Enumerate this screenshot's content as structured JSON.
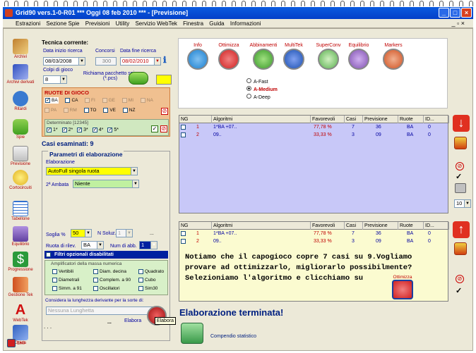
{
  "window": {
    "title": "Grid90 vers.1-0-R01   ***   Oggi 08 feb 2010   ***   - [Previsione]"
  },
  "menu": [
    "Estrazioni",
    "Sezione Spie",
    "Previsioni",
    "Utility",
    "Servizio WebTek",
    "Finestra",
    "Guida",
    "Informazioni"
  ],
  "sidebar": [
    "Archivi",
    "Archivi derivati",
    "Ritardi",
    "Spie",
    "Previsione",
    "Cortocircuiti",
    "Tabellone",
    "Equilibrio",
    "Progressione",
    "Gestione Tek",
    "WebTek",
    "Guida",
    "Esci"
  ],
  "tecnica": {
    "title": "Tecnica corrente:",
    "data_inizio_label": "Data inizio ricerca",
    "data_inizio": "08/03/2008",
    "concorsi_label": "Concorsi",
    "concorsi": "300",
    "data_fine_label": "Data fine ricerca",
    "data_fine": "08/02/2010",
    "colpi_label": "Colpi di gioco",
    "colpi": "8",
    "richiama_label": "Richiama pacchetto spia (*.pcs)"
  },
  "ruote": {
    "title": "RUOTE DI GIOCO",
    "row1": [
      "BA",
      "CA",
      "FI",
      "GE",
      "MI",
      "NA"
    ],
    "row2": [
      "PA",
      "RM",
      "TO",
      "VE",
      "NZ"
    ],
    "determinato_label": "Determinato [12345]",
    "det": [
      "1*",
      "2*",
      "3*",
      "4*",
      "5*"
    ]
  },
  "casi": "Casi esaminati: 9",
  "params": {
    "title": "Parametri di elaborazione",
    "elaborazione_label": "Elaborazione",
    "elaborazione": "AutoFull singola ruota",
    "ambata_label": "2ª Ambata",
    "ambata": "Niente",
    "soglia_label": "Soglia %",
    "soglia": "50",
    "nsoluz_label": "N Soluz.",
    "nsoluz": "1",
    "ruota_ril_label": "Ruota di rilev.",
    "ruota_ril": "BA",
    "num_abb_label": "Num di abb.",
    "num_abb": "1",
    "filtri": "Filtri opzionali disabilitati",
    "ampl_label": "Amplificatori della massa numerica",
    "ampl": [
      "Vertibili",
      "Diam. decina",
      "Quadrato",
      "Diametrali",
      "Complem. a 90",
      "Cubo",
      "Simm. a 91",
      "Oscillatori",
      "Sim30"
    ],
    "lunghezza_label": "Considera la lunghezza derivante per la sorte di:",
    "lunghezza": "Nessuna Lunghetta",
    "elabora_label": "Elabora",
    "elabora_tip": "Elabora",
    "dots": "...",
    "dots2": ". . ."
  },
  "tools": [
    {
      "label": "Info",
      "color": "#1a7fd0"
    },
    {
      "label": "Ottimizza",
      "color": "#d02020"
    },
    {
      "label": "Abbinamenti",
      "color": "#3a9a2a"
    },
    {
      "label": "MultiTek",
      "color": "#1a50b0"
    },
    {
      "label": "SuperConv",
      "color": "#5ab050"
    },
    {
      "label": "Equilibrio",
      "color": "#8050b0"
    },
    {
      "label": "Markers",
      "color": "#d05020"
    }
  ],
  "modes": [
    "A-Fast",
    "A-Medium",
    "A-Deep"
  ],
  "table": {
    "headers": [
      "NG",
      "Algoritmi",
      "Favorevoli",
      "Casi",
      "Previsione",
      "Ruote",
      "ID..."
    ],
    "rows": [
      {
        "ng": "1",
        "alg": "1*BA +07..",
        "fav": "77,78 %",
        "casi": "7",
        "prev": "36",
        "ruote": "BA",
        "id": "0"
      },
      {
        "ng": "2",
        "alg": "09..",
        "fav": "33,33 %",
        "casi": "3",
        "prev": "09",
        "ruote": "BA",
        "id": "0"
      }
    ]
  },
  "note": [
    "Notiamo che il capogioco copre 7 casi su 9.Vogliamo",
    "provare ad ottimizzarlo, migliorarlo possibilmente?",
    "Selezioniamo l'algoritmo e clicchiamo su"
  ],
  "note_btn": "Ottimizza",
  "status": "Elaborazione terminata!",
  "compendio": "Compendio statistico",
  "zoom": "10"
}
